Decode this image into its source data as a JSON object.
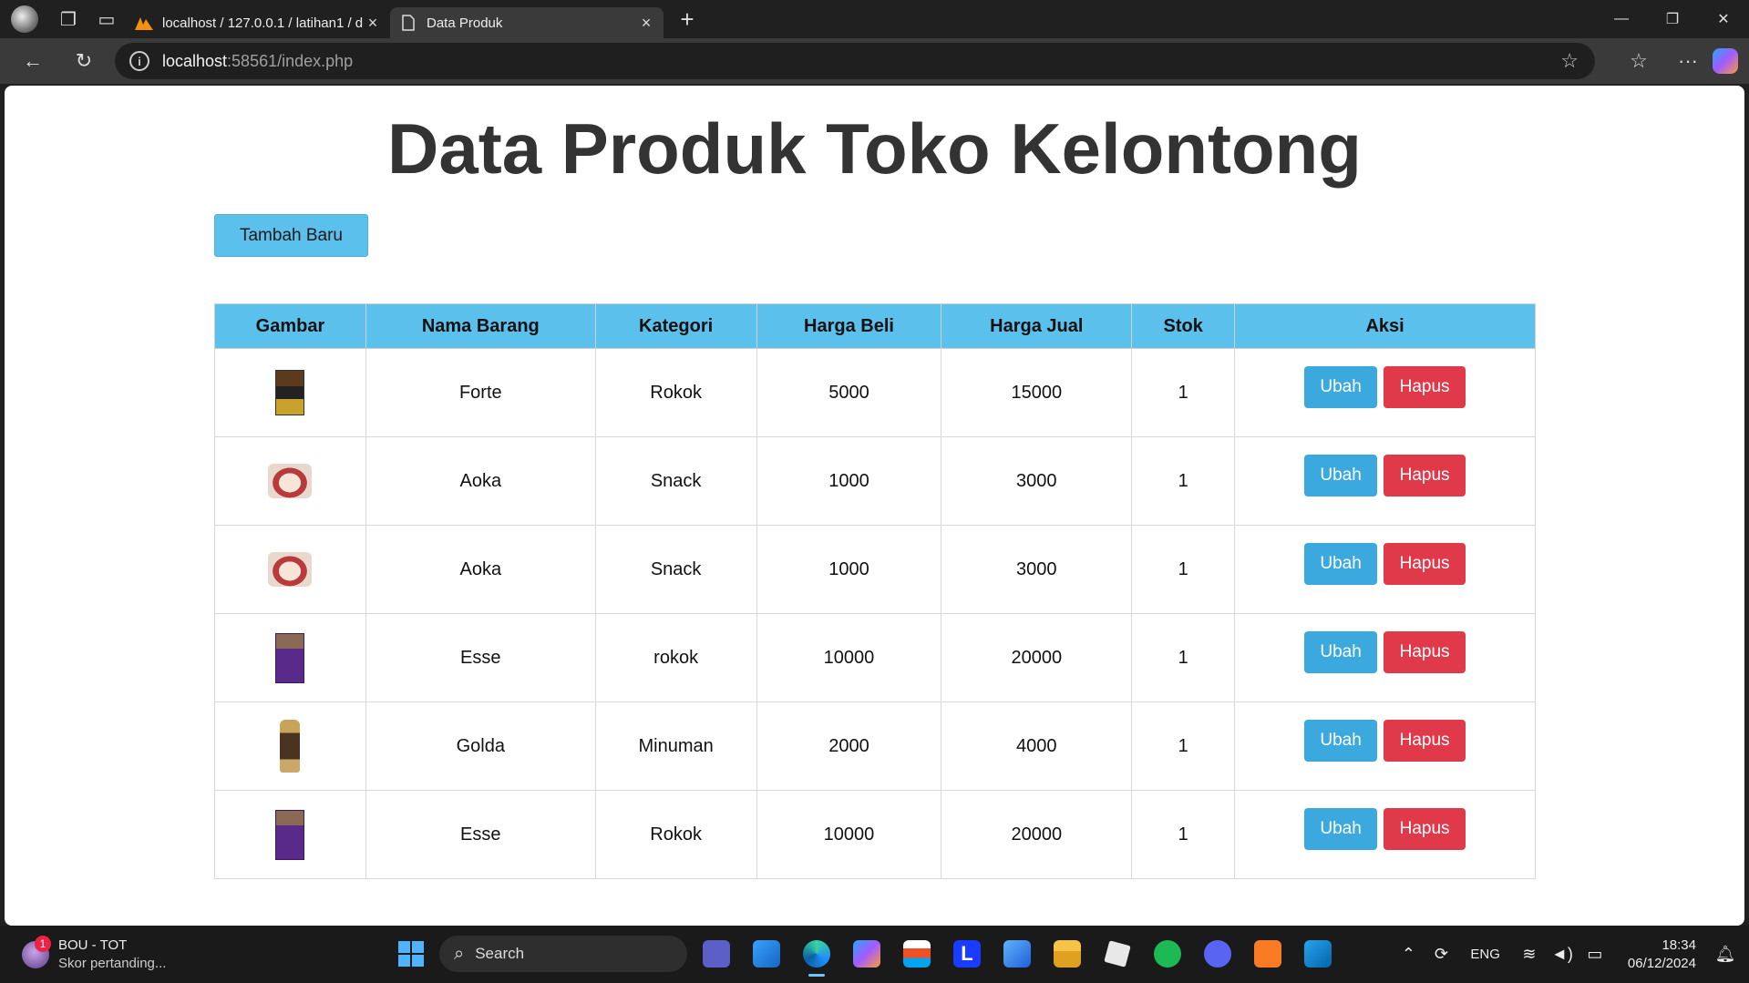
{
  "browser": {
    "tabs": [
      {
        "title": "localhost / 127.0.0.1 / latihan1 / d",
        "active": false
      },
      {
        "title": "Data Produk",
        "active": true
      }
    ],
    "url_host": "localhost",
    "url_rest": ":58561/index.php"
  },
  "page": {
    "title": "Data Produk Toko Kelontong",
    "add_button": "Tambah Baru",
    "table": {
      "headers": [
        "Gambar",
        "Nama Barang",
        "Kategori",
        "Harga Beli",
        "Harga Jual",
        "Stok",
        "Aksi"
      ],
      "rows": [
        {
          "image": "forte-cigarette-pack",
          "nama": "Forte",
          "kategori": "Rokok",
          "harga_beli": "5000",
          "harga_jual": "15000",
          "stok": "1"
        },
        {
          "image": "aoka-bread-pack",
          "nama": "Aoka",
          "kategori": "Snack",
          "harga_beli": "1000",
          "harga_jual": "3000",
          "stok": "1"
        },
        {
          "image": "aoka-bread-pack",
          "nama": "Aoka",
          "kategori": "Snack",
          "harga_beli": "1000",
          "harga_jual": "3000",
          "stok": "1"
        },
        {
          "image": "esse-cigarette-pack",
          "nama": "Esse",
          "kategori": "rokok",
          "harga_beli": "10000",
          "harga_jual": "20000",
          "stok": "1"
        },
        {
          "image": "golda-coffee-bottle",
          "nama": "Golda",
          "kategori": "Minuman",
          "harga_beli": "2000",
          "harga_jual": "4000",
          "stok": "1"
        },
        {
          "image": "esse-cigarette-pack",
          "nama": "Esse",
          "kategori": "Rokok",
          "harga_beli": "10000",
          "harga_jual": "20000",
          "stok": "1"
        }
      ],
      "edit_label": "Ubah",
      "delete_label": "Hapus"
    }
  },
  "taskbar": {
    "weather_title": "BOU - TOT",
    "weather_sub": "Skor pertanding...",
    "notification_count": "1",
    "search_placeholder": "Search",
    "language": "ENG",
    "time": "18:34",
    "date": "06/12/2024"
  },
  "colors": {
    "header_bg": "#5bc0eb",
    "edit_button": "#3ba9dd",
    "delete_button": "#e03a4a"
  }
}
